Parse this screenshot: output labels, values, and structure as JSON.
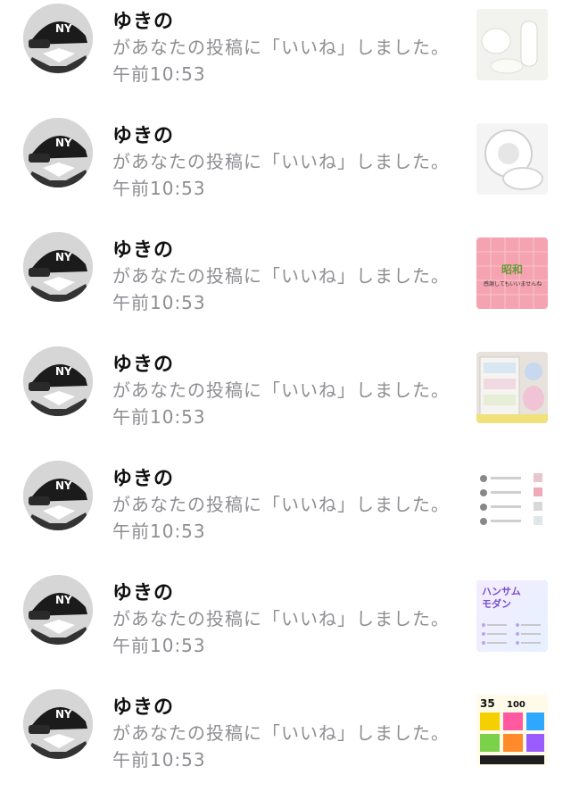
{
  "notifications": [
    {
      "user": "ゆきの",
      "message": "があなたの投稿に「いいね」しました。",
      "time": "午前10:53",
      "thumb_icon": "white-objects-photo"
    },
    {
      "user": "ゆきの",
      "message": "があなたの投稿に「いいね」しました。",
      "time": "午前10:53",
      "thumb_icon": "white-shapes-photo"
    },
    {
      "user": "ゆきの",
      "message": "があなたの投稿に「いいね」しました。",
      "time": "午前10:53",
      "thumb_icon": "pink-grid-photo"
    },
    {
      "user": "ゆきの",
      "message": "があなたの投稿に「いいね」しました。",
      "time": "午前10:53",
      "thumb_icon": "storage-shelf-photo"
    },
    {
      "user": "ゆきの",
      "message": "があなたの投稿に「いいね」しました。",
      "time": "午前10:53",
      "thumb_icon": "screenshot-list-photo"
    },
    {
      "user": "ゆきの",
      "message": "があなたの投稿に「いいね」しました。",
      "time": "午前10:53",
      "thumb_icon": "handsome-modern-card"
    },
    {
      "user": "ゆきの",
      "message": "があなたの投稿に「いいね」しました。",
      "time": "午前10:53",
      "thumb_icon": "colorful-collage-photo"
    }
  ],
  "thumb_texts": {
    "pink_title": "昭和",
    "pink_sub": "感謝してもいいませんね",
    "card_line1": "ハンサム",
    "card_line2": "モダン",
    "collage_a": "35",
    "collage_b": "100"
  }
}
